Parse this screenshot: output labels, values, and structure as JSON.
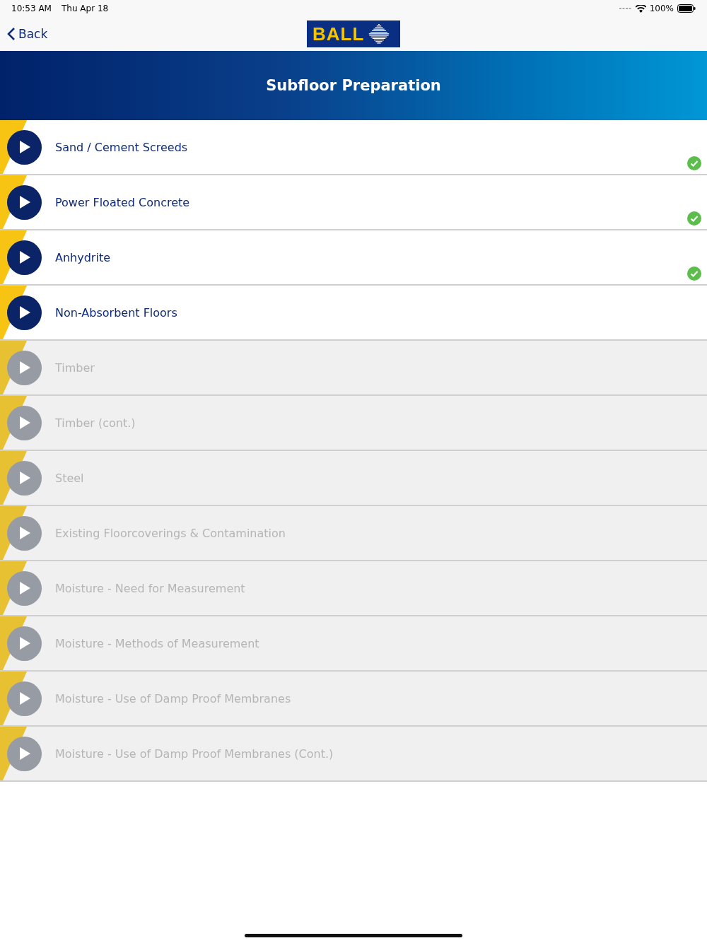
{
  "status_bar": {
    "time": "10:53 AM",
    "date": "Thu Apr 18",
    "battery": "100%"
  },
  "nav": {
    "back": "Back",
    "logo": "BALL"
  },
  "header": {
    "title": "Subfloor Preparation"
  },
  "items": [
    {
      "label": "Sand / Cement Screeds",
      "disabled": false,
      "completed": true
    },
    {
      "label": "Power Floated Concrete",
      "disabled": false,
      "completed": true
    },
    {
      "label": "Anhydrite",
      "disabled": false,
      "completed": true
    },
    {
      "label": "Non-Absorbent Floors",
      "disabled": false,
      "completed": false
    },
    {
      "label": "Timber",
      "disabled": true,
      "completed": false
    },
    {
      "label": "Timber (cont.)",
      "disabled": true,
      "completed": false
    },
    {
      "label": "Steel",
      "disabled": true,
      "completed": false
    },
    {
      "label": "Existing Floorcoverings & Contamination",
      "disabled": true,
      "completed": false
    },
    {
      "label": "Moisture - Need for Measurement",
      "disabled": true,
      "completed": false
    },
    {
      "label": "Moisture - Methods of Measurement",
      "disabled": true,
      "completed": false
    },
    {
      "label": "Moisture - Use of Damp Proof Membranes",
      "disabled": true,
      "completed": false
    },
    {
      "label": "Moisture - Use of Damp Proof Membranes (Cont.)",
      "disabled": true,
      "completed": false
    }
  ]
}
